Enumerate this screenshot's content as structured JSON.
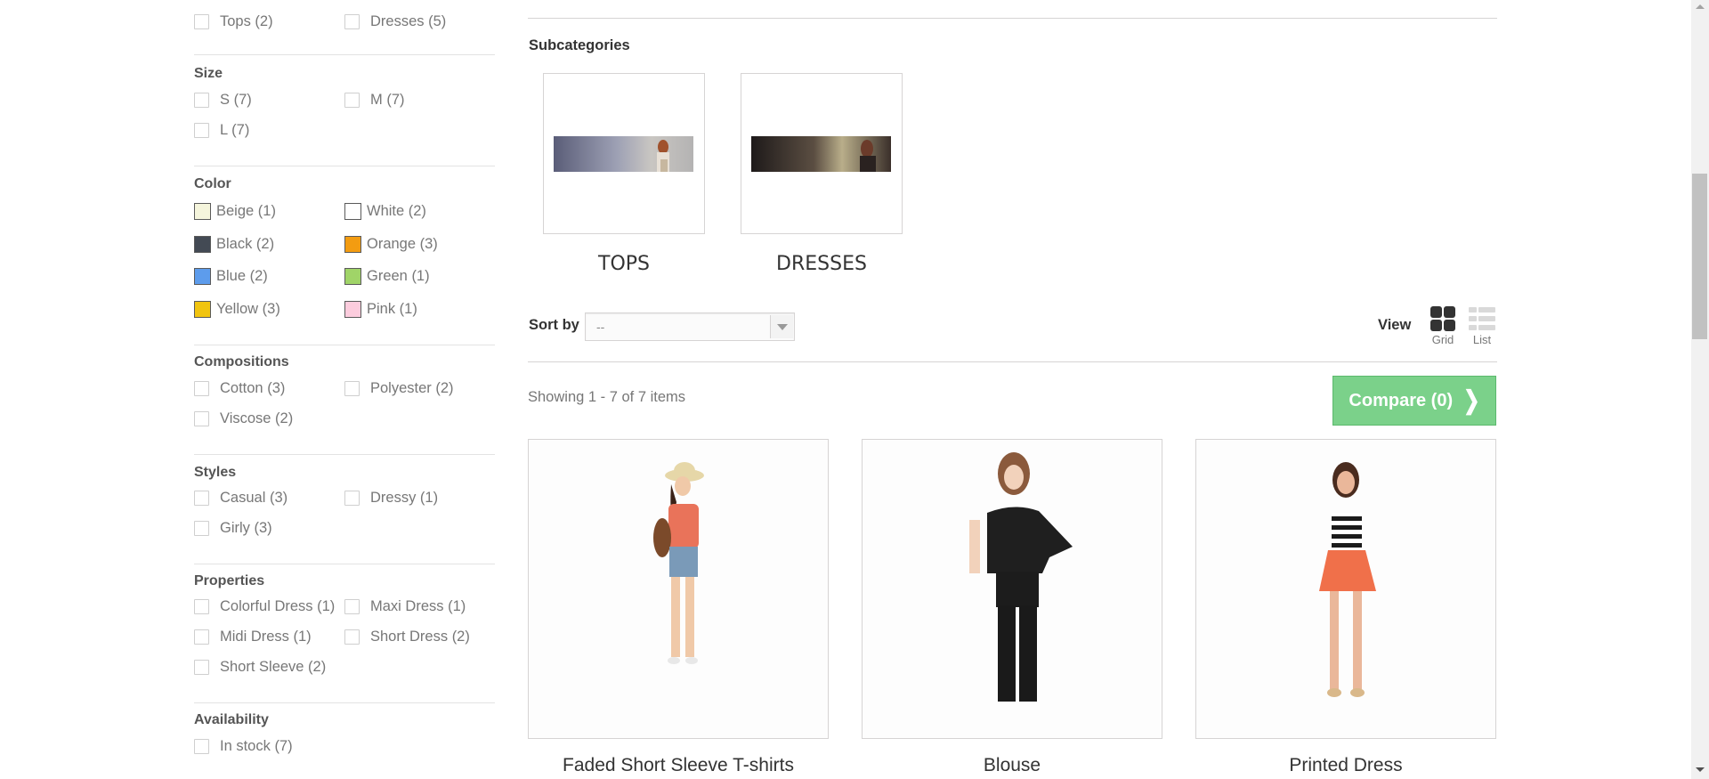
{
  "filters": {
    "categories": {
      "opt_tops": "Tops (2)",
      "opt_dresses": "Dresses (5)"
    },
    "size": {
      "title": "Size",
      "opt_s": "S (7)",
      "opt_m": "M (7)",
      "opt_l": "L (7)"
    },
    "color": {
      "title": "Color",
      "options": [
        {
          "label": "Beige (1)",
          "swatch": "#f5f5dc"
        },
        {
          "label": "White (2)",
          "swatch": "#ffffff"
        },
        {
          "label": "Black (2)",
          "swatch": "#434a54"
        },
        {
          "label": "Orange (3)",
          "swatch": "#f39c11"
        },
        {
          "label": "Blue (2)",
          "swatch": "#5d9cec"
        },
        {
          "label": "Green (1)",
          "swatch": "#a0d468"
        },
        {
          "label": "Yellow (3)",
          "swatch": "#f1c40f"
        },
        {
          "label": "Pink (1)",
          "swatch": "#fcccdd"
        }
      ]
    },
    "compositions": {
      "title": "Compositions",
      "opt_cotton": "Cotton (3)",
      "opt_polyester": "Polyester (2)",
      "opt_viscose": "Viscose (2)"
    },
    "styles": {
      "title": "Styles",
      "opt_casual": "Casual (3)",
      "opt_dressy": "Dressy (1)",
      "opt_girly": "Girly (3)"
    },
    "properties": {
      "title": "Properties",
      "opt_colorful": "Colorful Dress (1)",
      "opt_maxi": "Maxi Dress (1)",
      "opt_midi": "Midi Dress (1)",
      "opt_short_dress": "Short Dress (2)",
      "opt_short_sleeve": "Short Sleeve (2)"
    },
    "availability": {
      "title": "Availability",
      "opt_in_stock": "In stock (7)"
    }
  },
  "subcategories": {
    "heading": "Subcategories",
    "items": [
      {
        "name": "TOPS"
      },
      {
        "name": "DRESSES"
      }
    ]
  },
  "toolbar": {
    "sort_label": "Sort by",
    "sort_value": "--",
    "view_label": "View",
    "view_grid": "Grid",
    "view_list": "List",
    "showing": "Showing 1 - 7 of 7 items",
    "compare": "Compare (0)"
  },
  "products": [
    {
      "name": "Faded Short Sleeve T-shirts"
    },
    {
      "name": "Blouse"
    },
    {
      "name": "Printed Dress"
    }
  ],
  "colors": {
    "compare_bg": "#7bd18a",
    "border": "#d6d4d4",
    "heading": "#333333",
    "text": "#777777"
  }
}
